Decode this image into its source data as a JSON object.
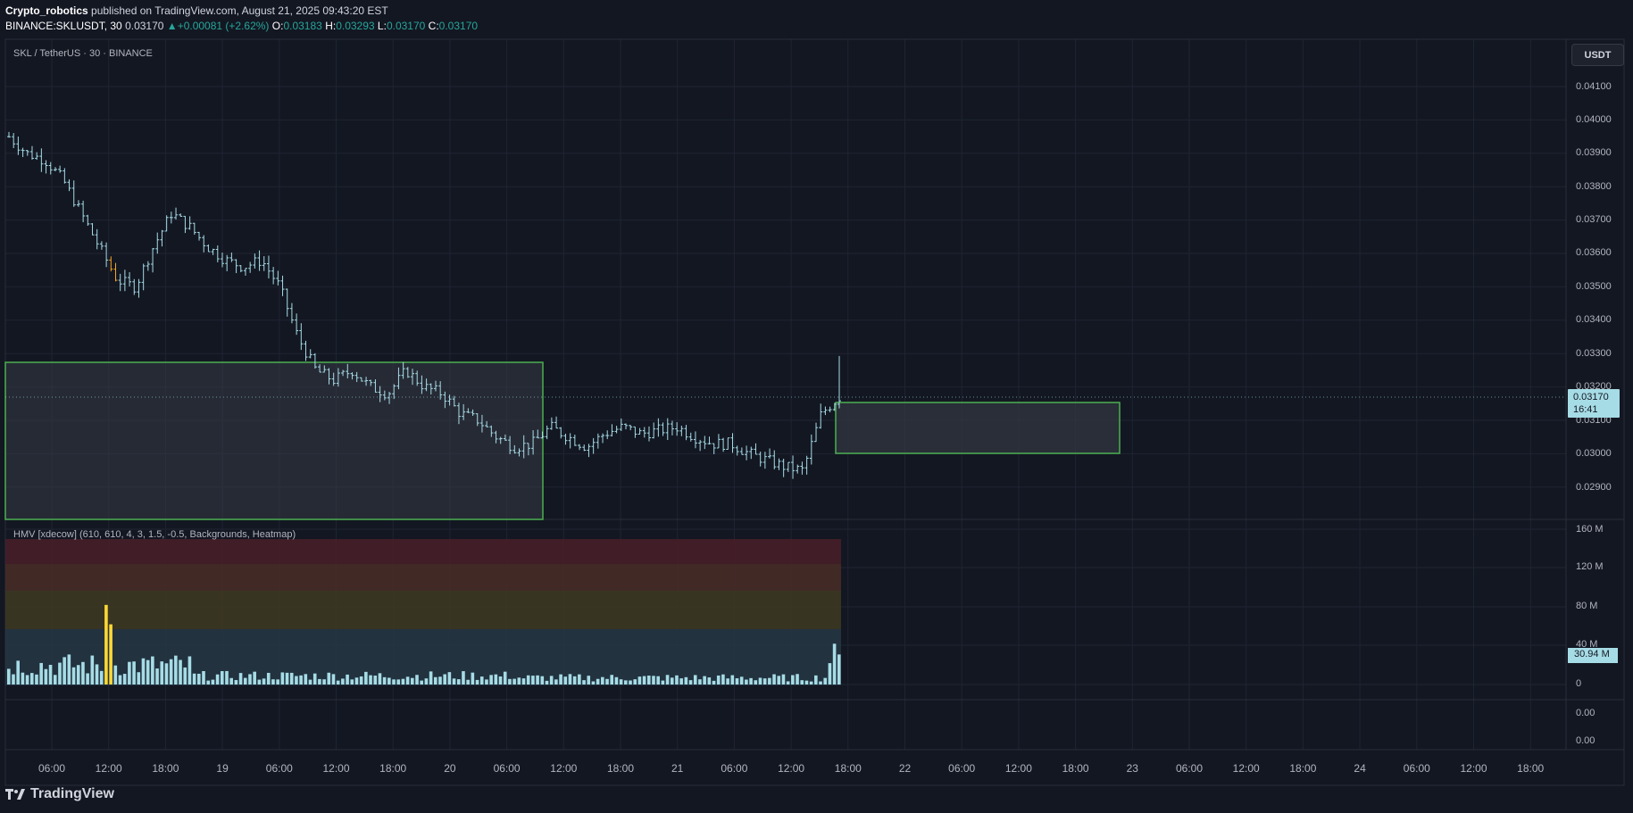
{
  "header": {
    "publisher": "Crypto_robotics",
    "published_text": "published on TradingView.com, August 21, 2025 09:43:20 EST",
    "ticker": "BINANCE:SKLUSDT, 30",
    "last": "0.03170",
    "change": "+0.00081 (+2.62%)",
    "o_label": "O:",
    "o": "0.03183",
    "h_label": "H:",
    "h": "0.03293",
    "l_label": "L:",
    "l": "0.03170",
    "c_label": "C:",
    "c": "0.03170"
  },
  "symbol_line": "SKL / TetherUS · 30 · BINANCE",
  "currency_button": "USDT",
  "indicator_line": "HMV [xdecow] (610, 610, 4, 3, 1.5, -0.5, Backgrounds, Heatmap)",
  "price_axis": [
    "0.04100",
    "0.04000",
    "0.03900",
    "0.03800",
    "0.03700",
    "0.03600",
    "0.03500",
    "0.03400",
    "0.03300",
    "0.03200",
    "0.03100",
    "0.03000",
    "0.02900"
  ],
  "current_price": {
    "price": "0.03170",
    "countdown": "16:41"
  },
  "volume_axis": [
    "160 M",
    "120 M",
    "80 M",
    "40 M",
    "0"
  ],
  "current_volume": "30.94 M",
  "empty_pane_axis": [
    "0.00",
    "0.00"
  ],
  "time_axis": [
    "06:00",
    "12:00",
    "18:00",
    "19",
    "06:00",
    "12:00",
    "18:00",
    "20",
    "06:00",
    "12:00",
    "18:00",
    "21",
    "06:00",
    "12:00",
    "18:00",
    "22",
    "06:00",
    "12:00",
    "18:00",
    "23",
    "06:00",
    "12:00",
    "18:00",
    "24",
    "06:00",
    "12:00",
    "18:00"
  ],
  "brand": "TradingView",
  "colors": {
    "background": "#131722",
    "grid": "#1f2433",
    "candle": "#a6dce6",
    "spike": "#f5a623",
    "zone_border": "#4caf50",
    "zone_fill": "#363a45",
    "volume_bar": "#a6dce6",
    "volume_spike": "#fdd835"
  },
  "chart_data": {
    "type": "candlestick",
    "timeframe": "30",
    "series": [
      {
        "name": "SKLUSDT",
        "close_path": [
          0.0395,
          0.039,
          0.0388,
          0.0382,
          0.0372,
          0.0362,
          0.0352,
          0.035,
          0.0362,
          0.0372,
          0.0368,
          0.0362,
          0.0358,
          0.0356,
          0.0358,
          0.035,
          0.0335,
          0.0325,
          0.0322,
          0.0325,
          0.032,
          0.0318,
          0.0325,
          0.032,
          0.0318,
          0.0312,
          0.031,
          0.0305,
          0.0302,
          0.0303,
          0.0308,
          0.0305,
          0.0302,
          0.0306,
          0.0308,
          0.0306,
          0.0307,
          0.0308,
          0.0305,
          0.0303,
          0.0303,
          0.03,
          0.0298,
          0.0296,
          0.0295,
          0.0312,
          0.0317
        ]
      }
    ],
    "zones": [
      {
        "from": "18 19:00",
        "to": "20 09:00",
        "low": 0.0287,
        "high": 0.0327
      },
      {
        "from": "21 18:00",
        "to": "22 22:00",
        "low": 0.03,
        "high": 0.0315
      }
    ],
    "volume_last": 30940000
  }
}
